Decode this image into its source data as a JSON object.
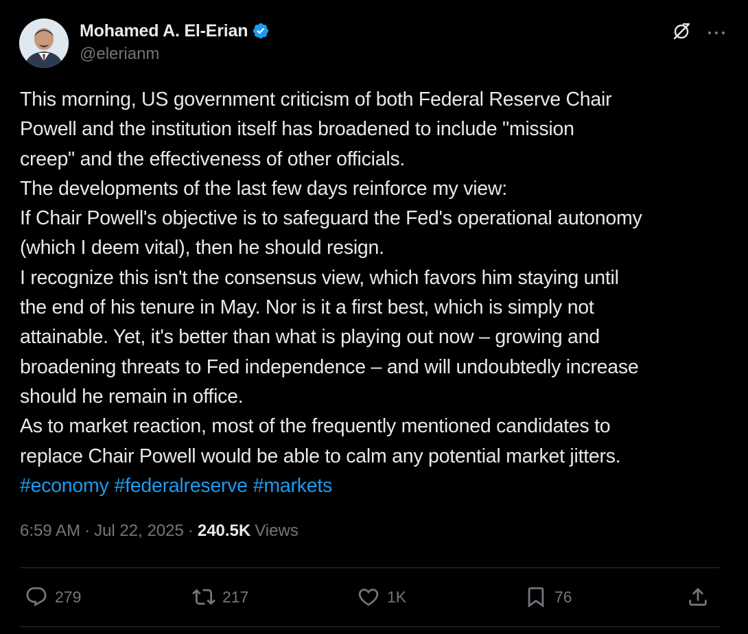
{
  "author": {
    "display_name": "Mohamed A. El-Erian",
    "handle": "@elerianm",
    "verified": true,
    "verified_color": "#1d9bf0"
  },
  "tweet": {
    "lines": [
      "This morning, US government criticism of both Federal Reserve Chair",
      "Powell and the institution itself has broadened to include \"mission",
      "creep\" and the effectiveness of other officials.",
      "The developments of the last few days reinforce my view:",
      "If Chair Powell's objective is to safeguard the Fed's operational autonomy",
      "(which I deem vital), then he should resign.",
      "I recognize this isn't the consensus view, which favors him staying until",
      "the end of his tenure in May. Nor is it a first best, which is simply not",
      "attainable. Yet, it's better than what is playing out now – growing and",
      "broadening threats to Fed independence – and will undoubtedly increase",
      "should he remain in office.",
      "As to market reaction, most of the frequently mentioned candidates to",
      "replace Chair Powell would be able to calm any potential market jitters."
    ],
    "hashtags": [
      "#economy",
      "#federalreserve",
      "#markets"
    ],
    "hashtag_color": "#1d9bf0"
  },
  "meta": {
    "time": "6:59 AM",
    "separator": "·",
    "date": "Jul 22, 2025",
    "views_count": "240.5K",
    "views_label": "Views"
  },
  "actions": {
    "replies": "279",
    "reposts": "217",
    "likes": "1K",
    "bookmarks": "76"
  },
  "icons": {
    "top_right": [
      "grok-icon",
      "more-icon"
    ],
    "action_bar": [
      "reply-icon",
      "retweet-icon",
      "like-icon",
      "bookmark-icon",
      "share-icon"
    ]
  },
  "colors": {
    "background": "#000000",
    "text_primary": "#e7e9ea",
    "text_secondary": "#71767b",
    "divider": "#2f3336"
  }
}
